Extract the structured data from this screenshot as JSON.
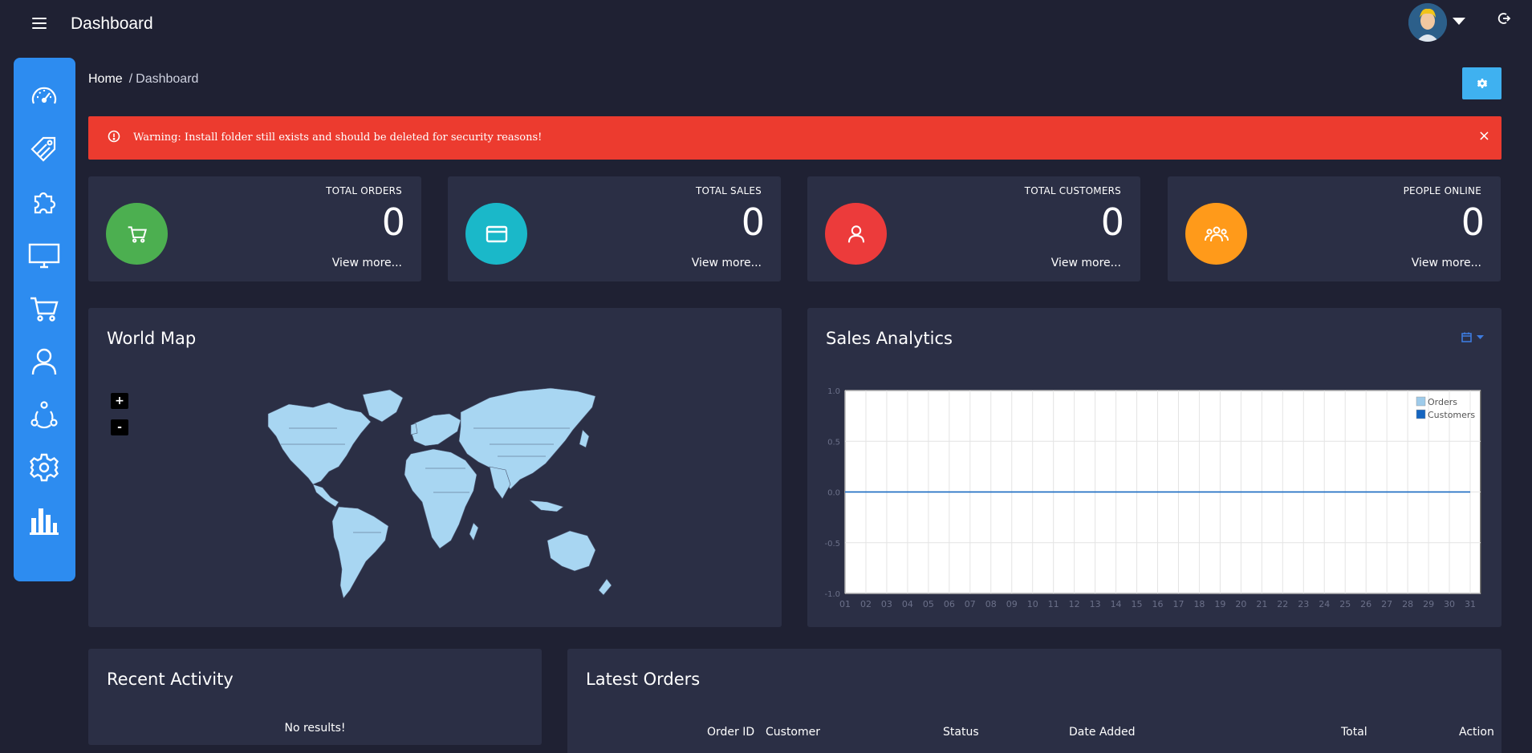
{
  "header": {
    "title": "Dashboard",
    "menu_icon": "hamburger-icon",
    "logout_icon": "logout-icon"
  },
  "sidebar": {
    "items": [
      {
        "icon": "speedometer-icon"
      },
      {
        "icon": "tag-icon"
      },
      {
        "icon": "puzzle-icon"
      },
      {
        "icon": "monitor-icon"
      },
      {
        "icon": "cart-icon"
      },
      {
        "icon": "user-icon"
      },
      {
        "icon": "share-nodes-icon"
      },
      {
        "icon": "gear-icon"
      },
      {
        "icon": "bar-chart-icon"
      }
    ]
  },
  "breadcrumb": {
    "home": "Home",
    "separator": "/",
    "current": "Dashboard"
  },
  "alert": {
    "text": "Warning: Install folder still exists and should be deleted for security reasons!",
    "close": "×"
  },
  "stats": [
    {
      "label": "TOTAL ORDERS",
      "value": "0",
      "link": "View more...",
      "color": "#4caf50",
      "icon": "cart-icon"
    },
    {
      "label": "TOTAL SALES",
      "value": "0",
      "link": "View more...",
      "color": "#1ab8c9",
      "icon": "credit-card-icon"
    },
    {
      "label": "TOTAL CUSTOMERS",
      "value": "0",
      "link": "View more...",
      "color": "#ec3b3b",
      "icon": "user-icon"
    },
    {
      "label": "PEOPLE ONLINE",
      "value": "0",
      "link": "View more...",
      "color": "#ff9a1a",
      "icon": "people-group-icon"
    }
  ],
  "world_map": {
    "title": "World Map",
    "zoom_in": "+",
    "zoom_out": "-",
    "land_color": "#a8d6f2"
  },
  "sales_analytics": {
    "title": "Sales Analytics",
    "range_icon": "calendar-icon"
  },
  "chart_data": {
    "type": "line",
    "categories": [
      "01",
      "02",
      "03",
      "04",
      "05",
      "06",
      "07",
      "08",
      "09",
      "10",
      "11",
      "12",
      "13",
      "14",
      "15",
      "16",
      "17",
      "18",
      "19",
      "20",
      "21",
      "22",
      "23",
      "24",
      "25",
      "26",
      "27",
      "28",
      "29",
      "30",
      "31"
    ],
    "series": [
      {
        "name": "Orders",
        "values": [
          0,
          0,
          0,
          0,
          0,
          0,
          0,
          0,
          0,
          0,
          0,
          0,
          0,
          0,
          0,
          0,
          0,
          0,
          0,
          0,
          0,
          0,
          0,
          0,
          0,
          0,
          0,
          0,
          0,
          0,
          0
        ],
        "color": "#9ecbea"
      },
      {
        "name": "Customers",
        "values": [
          0,
          0,
          0,
          0,
          0,
          0,
          0,
          0,
          0,
          0,
          0,
          0,
          0,
          0,
          0,
          0,
          0,
          0,
          0,
          0,
          0,
          0,
          0,
          0,
          0,
          0,
          0,
          0,
          0,
          0,
          0
        ],
        "color": "#1565c0"
      }
    ],
    "yticks": [
      "1.0",
      "0.5",
      "0.0",
      "-0.5",
      "-1.0"
    ],
    "ylim": [
      -1,
      1
    ],
    "grid": true,
    "legend": "top-right"
  },
  "recent_activity": {
    "title": "Recent Activity",
    "empty": "No results!"
  },
  "latest_orders": {
    "title": "Latest Orders",
    "columns": [
      "Order ID",
      "Customer",
      "Status",
      "Date Added",
      "Total",
      "Action"
    ]
  },
  "colors": {
    "background": "#1f2133",
    "card": "#2b2f45",
    "sidebar": "#2d8cf0",
    "alert": "#ec3b2f",
    "button": "#3fb1f0"
  }
}
